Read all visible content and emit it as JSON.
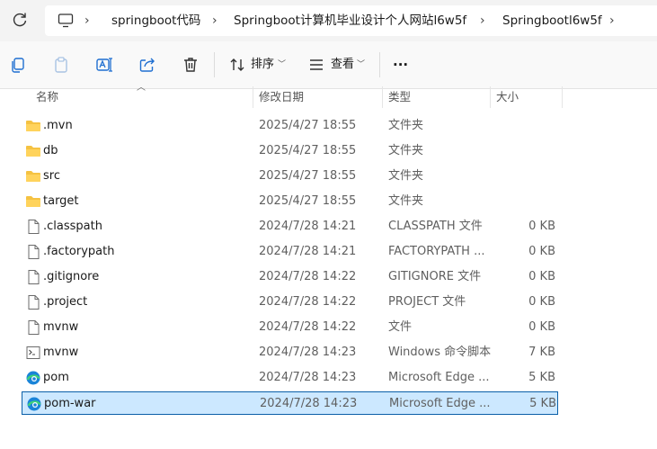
{
  "breadcrumb": [
    "springboot代码",
    "Springboot计算机毕业设计个人网站l6w5f",
    "Springbootl6w5f"
  ],
  "toolbar": {
    "sort_label": "排序",
    "view_label": "查看",
    "more_label": "···"
  },
  "columns": {
    "name": "名称",
    "date": "修改日期",
    "type": "类型",
    "size": "大小"
  },
  "files": [
    {
      "icon": "folder-icon",
      "name": ".mvn",
      "date": "2025/4/27 18:55",
      "type": "文件夹",
      "size": ""
    },
    {
      "icon": "folder-icon",
      "name": "db",
      "date": "2025/4/27 18:55",
      "type": "文件夹",
      "size": ""
    },
    {
      "icon": "folder-icon",
      "name": "src",
      "date": "2025/4/27 18:55",
      "type": "文件夹",
      "size": ""
    },
    {
      "icon": "folder-icon",
      "name": "target",
      "date": "2025/4/27 18:55",
      "type": "文件夹",
      "size": ""
    },
    {
      "icon": "file-icon",
      "name": ".classpath",
      "date": "2024/7/28 14:21",
      "type": "CLASSPATH 文件",
      "size": "0 KB"
    },
    {
      "icon": "file-icon",
      "name": ".factorypath",
      "date": "2024/7/28 14:21",
      "type": "FACTORYPATH ...",
      "size": "0 KB"
    },
    {
      "icon": "file-icon",
      "name": ".gitignore",
      "date": "2024/7/28 14:22",
      "type": "GITIGNORE 文件",
      "size": "0 KB"
    },
    {
      "icon": "file-icon",
      "name": ".project",
      "date": "2024/7/28 14:22",
      "type": "PROJECT 文件",
      "size": "0 KB"
    },
    {
      "icon": "file-icon",
      "name": "mvnw",
      "date": "2024/7/28 14:22",
      "type": "文件",
      "size": "0 KB"
    },
    {
      "icon": "script-file-icon",
      "name": "mvnw",
      "date": "2024/7/28 14:23",
      "type": "Windows 命令脚本",
      "size": "7 KB"
    },
    {
      "icon": "edge-icon",
      "name": "pom",
      "date": "2024/7/28 14:23",
      "type": "Microsoft Edge ...",
      "size": "5 KB"
    },
    {
      "icon": "edge-icon",
      "name": "pom-war",
      "date": "2024/7/28 14:23",
      "type": "Microsoft Edge ...",
      "size": "5 KB",
      "selected": true
    }
  ],
  "colors": {
    "selection_bg": "#cce8ff",
    "selection_border": "#0a5fa8",
    "folder": "#f5c242"
  }
}
